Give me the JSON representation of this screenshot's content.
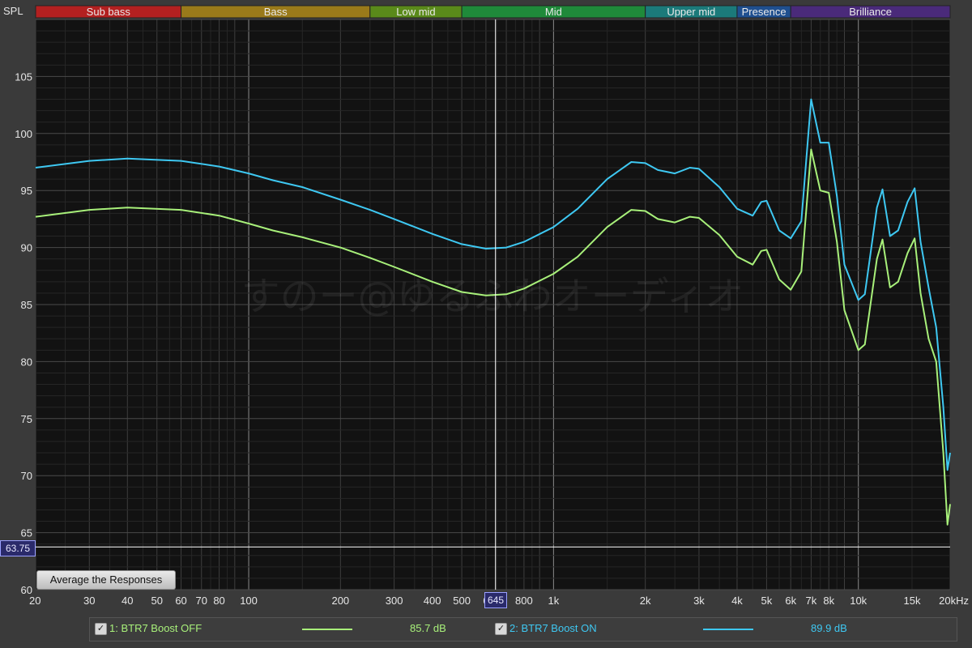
{
  "bands": [
    {
      "label": "Sub bass",
      "from": 20,
      "to": 60,
      "color": "#b32020"
    },
    {
      "label": "Bass",
      "from": 60,
      "to": 250,
      "color": "#9a7a1a"
    },
    {
      "label": "Low mid",
      "from": 250,
      "to": 500,
      "color": "#5a8a1a"
    },
    {
      "label": "Mid",
      "from": 500,
      "to": 2000,
      "color": "#1f8a3a"
    },
    {
      "label": "Upper mid",
      "from": 2000,
      "to": 4000,
      "color": "#1b7a7a"
    },
    {
      "label": "Presence",
      "from": 4000,
      "to": 6000,
      "color": "#1f4f8f"
    },
    {
      "label": "Brilliance",
      "from": 6000,
      "to": 20000,
      "color": "#4a2a7a"
    }
  ],
  "watermark": "すのー@ゆるふわオーディオ",
  "cursor": {
    "x_label": "645",
    "y_label": "63.75"
  },
  "average_button": "Average the Responses",
  "legend": [
    {
      "label": "1: BTR7 Boost OFF",
      "value": "85.7 dB",
      "color": "#a8f07a",
      "check": "✓"
    },
    {
      "label": "2: BTR7 Boost ON",
      "value": "89.9 dB",
      "color": "#3ec8f2",
      "check": "✓"
    }
  ],
  "chart_data": {
    "type": "line",
    "xscale": "log",
    "xlim": [
      20,
      20000
    ],
    "ylim": [
      60,
      110
    ],
    "ylabel": "SPL",
    "x_ticks": [
      20,
      30,
      40,
      50,
      60,
      70,
      80,
      100,
      200,
      300,
      400,
      500,
      600,
      800,
      1000,
      2000,
      3000,
      4000,
      5000,
      6000,
      7000,
      8000,
      10000,
      15000,
      20000
    ],
    "x_tick_labels": [
      "20",
      "30",
      "40",
      "50",
      "60",
      "70",
      "80",
      "100",
      "200",
      "300",
      "400",
      "500",
      "6",
      "800",
      "1k",
      "2k",
      "3k",
      "4k",
      "5k",
      "6k",
      "7k",
      "8k",
      "10k",
      "15k",
      "20kHz"
    ],
    "y_ticks": [
      60,
      65,
      70,
      75,
      80,
      85,
      90,
      95,
      100,
      105
    ],
    "grid": true,
    "series": [
      {
        "name": "1: BTR7 Boost OFF",
        "color": "#a8f07a",
        "points": [
          [
            20,
            92.7
          ],
          [
            30,
            93.3
          ],
          [
            40,
            93.5
          ],
          [
            60,
            93.3
          ],
          [
            80,
            92.8
          ],
          [
            100,
            92.1
          ],
          [
            120,
            91.5
          ],
          [
            150,
            90.9
          ],
          [
            200,
            90.0
          ],
          [
            250,
            89.1
          ],
          [
            300,
            88.3
          ],
          [
            400,
            87.0
          ],
          [
            500,
            86.1
          ],
          [
            600,
            85.8
          ],
          [
            700,
            85.9
          ],
          [
            800,
            86.4
          ],
          [
            1000,
            87.7
          ],
          [
            1200,
            89.2
          ],
          [
            1500,
            91.8
          ],
          [
            1800,
            93.3
          ],
          [
            2000,
            93.2
          ],
          [
            2200,
            92.5
          ],
          [
            2500,
            92.2
          ],
          [
            2800,
            92.7
          ],
          [
            3000,
            92.6
          ],
          [
            3500,
            91.1
          ],
          [
            4000,
            89.2
          ],
          [
            4500,
            88.5
          ],
          [
            4800,
            89.7
          ],
          [
            5000,
            89.8
          ],
          [
            5500,
            87.2
          ],
          [
            6000,
            86.3
          ],
          [
            6500,
            87.9
          ],
          [
            7000,
            98.6
          ],
          [
            7500,
            95.0
          ],
          [
            8000,
            94.8
          ],
          [
            8500,
            90.5
          ],
          [
            9000,
            84.5
          ],
          [
            10000,
            81.0
          ],
          [
            10500,
            81.5
          ],
          [
            11500,
            89.0
          ],
          [
            12000,
            90.7
          ],
          [
            12700,
            86.5
          ],
          [
            13500,
            87.0
          ],
          [
            14500,
            89.5
          ],
          [
            15300,
            90.8
          ],
          [
            16000,
            86.0
          ],
          [
            17000,
            82.0
          ],
          [
            18000,
            80.0
          ],
          [
            19000,
            72.0
          ],
          [
            19600,
            65.7
          ],
          [
            20000,
            67.5
          ]
        ]
      },
      {
        "name": "2: BTR7 Boost ON",
        "color": "#3ec8f2",
        "points": [
          [
            20,
            97.0
          ],
          [
            30,
            97.6
          ],
          [
            40,
            97.8
          ],
          [
            60,
            97.6
          ],
          [
            80,
            97.1
          ],
          [
            100,
            96.5
          ],
          [
            120,
            95.9
          ],
          [
            150,
            95.3
          ],
          [
            200,
            94.2
          ],
          [
            250,
            93.3
          ],
          [
            300,
            92.5
          ],
          [
            400,
            91.2
          ],
          [
            500,
            90.3
          ],
          [
            600,
            89.9
          ],
          [
            700,
            90.0
          ],
          [
            800,
            90.5
          ],
          [
            1000,
            91.8
          ],
          [
            1200,
            93.4
          ],
          [
            1500,
            96.0
          ],
          [
            1800,
            97.5
          ],
          [
            2000,
            97.4
          ],
          [
            2200,
            96.8
          ],
          [
            2500,
            96.5
          ],
          [
            2800,
            97.0
          ],
          [
            3000,
            96.9
          ],
          [
            3500,
            95.3
          ],
          [
            4000,
            93.4
          ],
          [
            4500,
            92.8
          ],
          [
            4800,
            94.0
          ],
          [
            5000,
            94.1
          ],
          [
            5500,
            91.5
          ],
          [
            6000,
            90.8
          ],
          [
            6500,
            92.3
          ],
          [
            7000,
            103.0
          ],
          [
            7500,
            99.2
          ],
          [
            8000,
            99.2
          ],
          [
            8500,
            94.5
          ],
          [
            9000,
            88.5
          ],
          [
            10000,
            85.4
          ],
          [
            10500,
            85.9
          ],
          [
            11500,
            93.5
          ],
          [
            12000,
            95.1
          ],
          [
            12700,
            91.0
          ],
          [
            13500,
            91.5
          ],
          [
            14500,
            94.0
          ],
          [
            15300,
            95.2
          ],
          [
            16000,
            90.5
          ],
          [
            17000,
            86.5
          ],
          [
            18000,
            83.0
          ],
          [
            19000,
            76.0
          ],
          [
            19600,
            70.5
          ],
          [
            20000,
            72.0
          ]
        ]
      }
    ]
  }
}
